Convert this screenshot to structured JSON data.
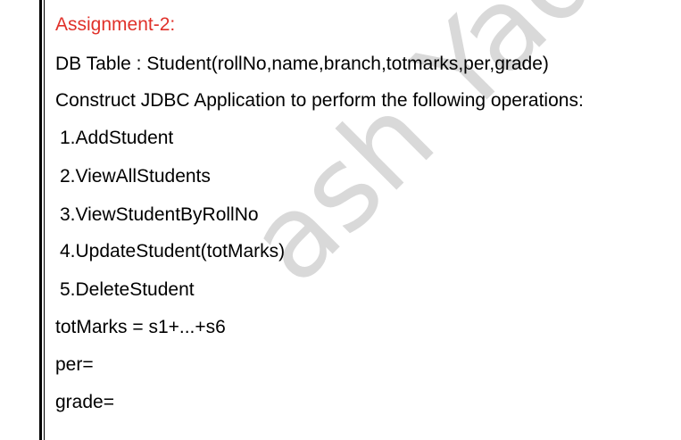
{
  "document": {
    "title": "Assignment-2:",
    "db_table": "DB Table : Student(rollNo,name,branch,totmarks,per,grade)",
    "instruction": "Construct JDBC Application to perform the following operations:",
    "operations": [
      "1.AddStudent",
      "2.ViewAllStudents",
      "3.ViewStudentByRollNo",
      "4.UpdateStudent(totMarks)",
      "5.DeleteStudent"
    ],
    "formulas": [
      "totMarks = s1+...+s6",
      "per=",
      "grade="
    ]
  },
  "watermark": {
    "text": "ash Yadav"
  },
  "colors": {
    "title": "#e0312a",
    "text": "#000000",
    "watermark": "#d9d9d9"
  }
}
